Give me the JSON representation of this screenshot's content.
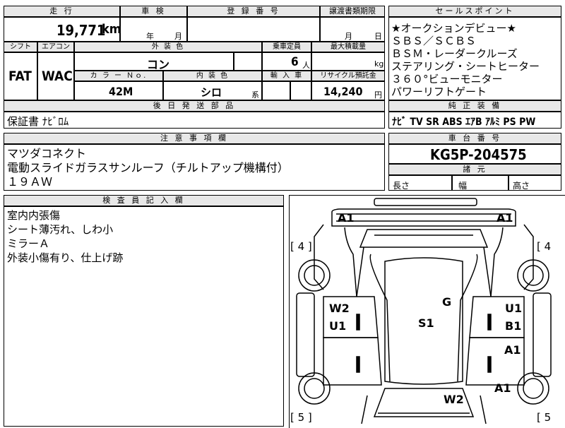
{
  "header": {
    "mileage_label": "走 行",
    "shaken_label": "車 検",
    "registration_label": "登 録 番 号",
    "transfer_docs_label": "譲渡書類期限",
    "sales_points_label": "セールスポイント"
  },
  "top_row": {
    "mileage": "19,771",
    "mileage_unit": "km",
    "shaken_year_label": "年",
    "shaken_month_label": "月",
    "transfer_month_label": "月",
    "transfer_day_label": "日"
  },
  "specs": {
    "shift_label": "シフト",
    "aircon_label": "エアコン",
    "exterior_color_label": "外 装 色",
    "capacity_label": "乗車定員",
    "max_load_label": "最大積載量",
    "shift": "FAT",
    "aircon": "WAC",
    "exterior_color": "コン",
    "capacity": "6",
    "capacity_unit": "人",
    "max_load_unit": "kg",
    "color_no_label": "カ ラ ー Ｎｏ.",
    "interior_color_label": "内 装 色",
    "import_label": "輸 入 車",
    "recycle_label": "リサイクル預託金",
    "color_no": "42M",
    "interior_color": "シロ",
    "interior_suffix": "系",
    "recycle_fee": "14,240",
    "recycle_unit": "円"
  },
  "parts": {
    "label": "後 日 発 送 部 品",
    "value": "保証書 ﾅﾋﾞﾛﾑ"
  },
  "sales_points": [
    "★オークションデビュー★",
    "ＳＢＳ／ＳＣＢＳ",
    "ＢＳＭ・レーダークルーズ",
    "ステアリング・シートヒーター",
    "３６０°ビューモニター",
    "パワーリフトゲート"
  ],
  "equipment": {
    "label": "純 正 装 備",
    "value": "ﾅﾋﾞ TV SR ABS ｴｱB ｱﾙﾐ PS PW"
  },
  "notes": {
    "label": "注 意 事 項 欄",
    "lines": [
      "マツダコネクト",
      "電動スライドガラスサンルーフ（チルトアップ機構付）",
      "１９ＡＷ"
    ]
  },
  "chassis": {
    "label": "車 台 番 号",
    "value": "KG5P-204575"
  },
  "dimensions": {
    "label": "諸 元",
    "length_label": "長さ",
    "width_label": "幅",
    "height_label": "高さ"
  },
  "inspector": {
    "label": "検 査 員 記 入 欄",
    "lines": [
      "室内内張傷",
      "シート薄汚れ、しわ小",
      "ミラーＡ",
      "外装小傷有り、仕上げ跡"
    ]
  },
  "diagram": {
    "marks": {
      "front_left": "A1",
      "front_right": "A1",
      "left_door_top": "W2",
      "left_door_bottom": "U1",
      "center_g": "G",
      "center_s": "S1",
      "right_door_u": "U1",
      "right_door_b": "B1",
      "right_mid": "A1",
      "right_rear": "A1",
      "rear_w": "W2"
    },
    "tires": {
      "front_left": "[ 4 ]",
      "front_right": "[ 4",
      "rear_left": "[ 5 ]",
      "rear_right": "[ 5"
    }
  }
}
